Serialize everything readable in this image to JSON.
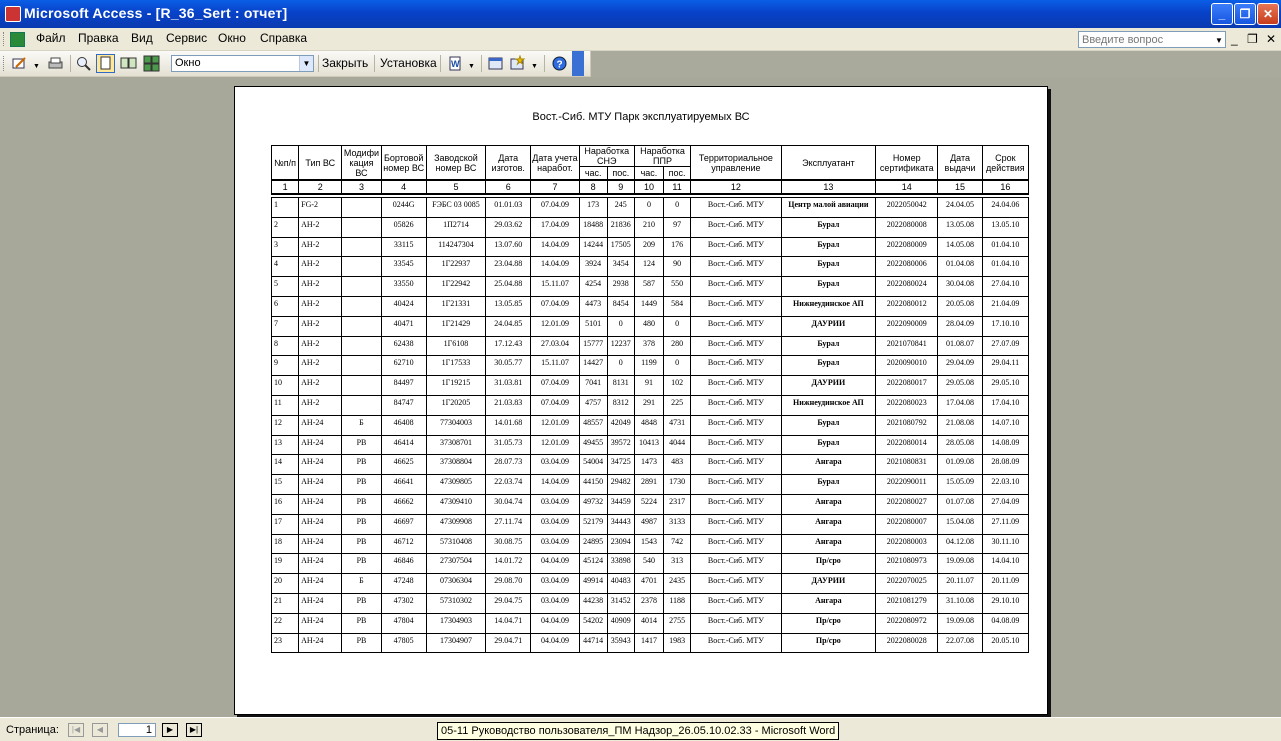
{
  "window": {
    "title": "Microsoft Access - [R_36_Sert : отчет]"
  },
  "menu": {
    "items": [
      "Файл",
      "Правка",
      "Вид",
      "Сервис",
      "Окно",
      "Справка"
    ],
    "ask_placeholder": "Введите вопрос"
  },
  "toolbar": {
    "view_value": "Окно",
    "close_label": "Закрыть",
    "setup_label": "Установка"
  },
  "report": {
    "title": "Вост.-Сиб. МТУ Парк эксплуатируемых ВС",
    "headers": {
      "num": "№п/п",
      "type": "Тип ВС",
      "mod": "Модифи кация ВС",
      "board": "Бортовой номер ВС",
      "factory": "Заводской номер ВС",
      "made": "Дата изготов.",
      "acct": "Дата учета наработ.",
      "since_new": "Наработка СНЭ",
      "since_repair": "Наработка ППР",
      "hours": "час.",
      "landings": "пос.",
      "tu": "Территориальное управление",
      "operator": "Эксплуатант",
      "cert_no": "Номер сертификата",
      "issued": "Дата выдачи",
      "validity": "Срок действия"
    },
    "column_numbers": [
      "1",
      "2",
      "3",
      "4",
      "5",
      "6",
      "7",
      "8",
      "9",
      "10",
      "11",
      "12",
      "13",
      "14",
      "15",
      "16"
    ],
    "rows": [
      [
        "1",
        "FG-2",
        "",
        "0244G",
        "FЭБС 03 0085",
        "01.01.03",
        "07.04.09",
        "173",
        "245",
        "0",
        "0",
        "Вост.-Сиб. МТУ",
        "Центр малой авиации",
        "2022050042",
        "24.04.05",
        "24.04.06"
      ],
      [
        "2",
        "АН-2",
        "",
        "05826",
        "1П2714",
        "29.03.62",
        "17.04.09",
        "18488",
        "21836",
        "210",
        "97",
        "Вост.-Сиб. МТУ",
        "Бурал",
        "2022080008",
        "13.05.08",
        "13.05.10"
      ],
      [
        "3",
        "АН-2",
        "",
        "33115",
        "114247304",
        "13.07.60",
        "14.04.09",
        "14244",
        "17505",
        "209",
        "176",
        "Вост.-Сиб. МТУ",
        "Бурал",
        "2022080009",
        "14.05.08",
        "01.04.10"
      ],
      [
        "4",
        "АН-2",
        "",
        "33545",
        "1Г22937",
        "23.04.88",
        "14.04.09",
        "3924",
        "3454",
        "124",
        "90",
        "Вост.-Сиб. МТУ",
        "Бурал",
        "2022080006",
        "01.04.08",
        "01.04.10"
      ],
      [
        "5",
        "АН-2",
        "",
        "33550",
        "1Г22942",
        "25.04.88",
        "15.11.07",
        "4254",
        "2938",
        "587",
        "550",
        "Вост.-Сиб. МТУ",
        "Бурал",
        "2022080024",
        "30.04.08",
        "27.04.10"
      ],
      [
        "6",
        "АН-2",
        "",
        "40424",
        "1Г21331",
        "13.05.85",
        "07.04.09",
        "4473",
        "8454",
        "1449",
        "584",
        "Вост.-Сиб. МТУ",
        "Нижнеудинское АП",
        "2022080012",
        "20.05.08",
        "21.04.09"
      ],
      [
        "7",
        "АН-2",
        "",
        "40471",
        "1Г21429",
        "24.04.85",
        "12.01.09",
        "5101",
        "0",
        "480",
        "0",
        "Вост.-Сиб. МТУ",
        "ДАУРИИ",
        "2022090009",
        "28.04.09",
        "17.10.10"
      ],
      [
        "8",
        "АН-2",
        "",
        "62438",
        "1Г6108",
        "17.12.43",
        "27.03.04",
        "15777",
        "12237",
        "378",
        "280",
        "Вост.-Сиб. МТУ",
        "Бурал",
        "2021070841",
        "01.08.07",
        "27.07.09"
      ],
      [
        "9",
        "АН-2",
        "",
        "62710",
        "1Г17533",
        "30.05.77",
        "15.11.07",
        "14427",
        "0",
        "1199",
        "0",
        "Вост.-Сиб. МТУ",
        "Бурал",
        "2020090010",
        "29.04.09",
        "29.04.11"
      ],
      [
        "10",
        "АН-2",
        "",
        "84497",
        "1Г19215",
        "31.03.81",
        "07.04.09",
        "7041",
        "8131",
        "91",
        "102",
        "Вост.-Сиб. МТУ",
        "ДАУРИИ",
        "2022080017",
        "29.05.08",
        "29.05.10"
      ],
      [
        "11",
        "АН-2",
        "",
        "84747",
        "1Г20205",
        "21.03.83",
        "07.04.09",
        "4757",
        "8312",
        "291",
        "225",
        "Вост.-Сиб. МТУ",
        "Нижнеудинское АП",
        "2022080023",
        "17.04.08",
        "17.04.10"
      ],
      [
        "12",
        "АН-24",
        "Б",
        "46408",
        "77304003",
        "14.01.68",
        "12.01.09",
        "48557",
        "42049",
        "4848",
        "4731",
        "Вост.-Сиб. МТУ",
        "Бурал",
        "2021080792",
        "21.08.08",
        "14.07.10"
      ],
      [
        "13",
        "АН-24",
        "РВ",
        "46414",
        "37308701",
        "31.05.73",
        "12.01.09",
        "49455",
        "39572",
        "10413",
        "4044",
        "Вост.-Сиб. МТУ",
        "Бурал",
        "2022080014",
        "28.05.08",
        "14.08.09"
      ],
      [
        "14",
        "АН-24",
        "РВ",
        "46625",
        "37308804",
        "28.07.73",
        "03.04.09",
        "54004",
        "34725",
        "1473",
        "483",
        "Вост.-Сиб. МТУ",
        "Ангара",
        "2021080831",
        "01.09.08",
        "28.08.09"
      ],
      [
        "15",
        "АН-24",
        "РВ",
        "46641",
        "47309805",
        "22.03.74",
        "14.04.09",
        "44150",
        "29482",
        "2891",
        "1730",
        "Вост.-Сиб. МТУ",
        "Бурал",
        "2022090011",
        "15.05.09",
        "22.03.10"
      ],
      [
        "16",
        "АН-24",
        "РВ",
        "46662",
        "47309410",
        "30.04.74",
        "03.04.09",
        "49732",
        "34459",
        "5224",
        "2317",
        "Вост.-Сиб. МТУ",
        "Ангара",
        "2022080027",
        "01.07.08",
        "27.04.09"
      ],
      [
        "17",
        "АН-24",
        "РВ",
        "46697",
        "47309908",
        "27.11.74",
        "03.04.09",
        "52179",
        "34443",
        "4987",
        "3133",
        "Вост.-Сиб. МТУ",
        "Ангара",
        "2022080007",
        "15.04.08",
        "27.11.09"
      ],
      [
        "18",
        "АН-24",
        "РВ",
        "46712",
        "57310408",
        "30.08.75",
        "03.04.09",
        "24895",
        "23094",
        "1543",
        "742",
        "Вост.-Сиб. МТУ",
        "Ангара",
        "2022080003",
        "04.12.08",
        "30.11.10"
      ],
      [
        "19",
        "АН-24",
        "РВ",
        "46846",
        "27307504",
        "14.01.72",
        "04.04.09",
        "45124",
        "33898",
        "540",
        "313",
        "Вост.-Сиб. МТУ",
        "Пр/сро",
        "2021080973",
        "19.09.08",
        "14.04.10"
      ],
      [
        "20",
        "АН-24",
        "Б",
        "47248",
        "07306304",
        "29.08.70",
        "03.04.09",
        "49914",
        "40483",
        "4701",
        "2435",
        "Вост.-Сиб. МТУ",
        "ДАУРИИ",
        "2022070025",
        "20.11.07",
        "20.11.09"
      ],
      [
        "21",
        "АН-24",
        "РВ",
        "47302",
        "57310302",
        "29.04.75",
        "03.04.09",
        "44238",
        "31452",
        "2378",
        "1188",
        "Вост.-Сиб. МТУ",
        "Ангара",
        "2021081279",
        "31.10.08",
        "29.10.10"
      ],
      [
        "22",
        "АН-24",
        "РВ",
        "47804",
        "17304903",
        "14.04.71",
        "04.04.09",
        "54202",
        "40909",
        "4014",
        "2755",
        "Вост.-Сиб. МТУ",
        "Пр/сро",
        "2022080972",
        "19.09.08",
        "04.08.09"
      ],
      [
        "23",
        "АН-24",
        "РВ",
        "47805",
        "17304907",
        "29.04.71",
        "04.04.09",
        "44714",
        "35943",
        "1417",
        "1983",
        "Вост.-Сиб. МТУ",
        "Пр/сро",
        "2022080028",
        "22.07.08",
        "20.05.10"
      ]
    ]
  },
  "status": {
    "page_label": "Страница:",
    "page_value": "1",
    "taskbar_tip": "05-11 Руководство пользователя_ПМ Надзор_26.05.10.02.33 - Microsoft Word"
  },
  "colors": {
    "titlebar": "#0842c8",
    "chrome": "#ece9d8",
    "canvas": "#a8a89a"
  }
}
